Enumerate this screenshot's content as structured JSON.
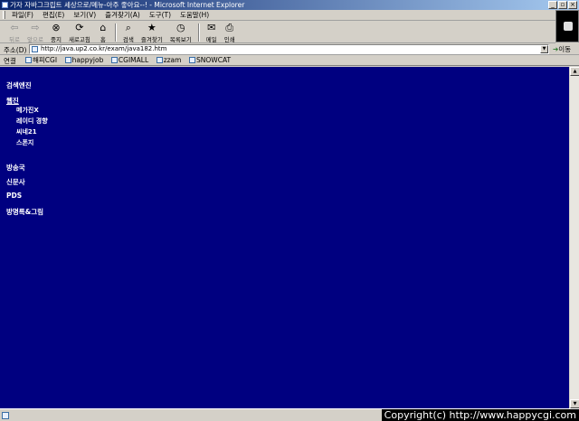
{
  "window": {
    "title": "가자 자바그크립트 세상으로/메뉴-아주 좋아요--! - Microsoft Internet Explorer",
    "controls": [
      "_",
      "▫",
      "×"
    ]
  },
  "menu": [
    "파일(F)",
    "편집(E)",
    "보기(V)",
    "즐겨찾기(A)",
    "도구(T)",
    "도움말(H)"
  ],
  "toolbar": [
    {
      "label": "뒤로",
      "icon": "back-arrow-icon",
      "glyph": "⇦",
      "disabled": true
    },
    {
      "label": "앞으로",
      "icon": "forward-arrow-icon",
      "glyph": "⇨",
      "disabled": true
    },
    {
      "label": "중지",
      "icon": "stop-icon",
      "glyph": "⊗",
      "disabled": false
    },
    {
      "label": "새로고침",
      "icon": "refresh-icon",
      "glyph": "⟳",
      "disabled": false
    },
    {
      "label": "홈",
      "icon": "home-icon",
      "glyph": "⌂",
      "disabled": false
    },
    {
      "label": "검색",
      "icon": "search-icon",
      "glyph": "⌕",
      "disabled": false
    },
    {
      "label": "즐겨찾기",
      "icon": "favorites-icon",
      "glyph": "★",
      "disabled": false
    },
    {
      "label": "목록보기",
      "icon": "history-icon",
      "glyph": "◷",
      "disabled": false
    },
    {
      "label": "메일",
      "icon": "mail-icon",
      "glyph": "✉",
      "disabled": false
    },
    {
      "label": "인쇄",
      "icon": "print-icon",
      "glyph": "⎙",
      "disabled": false
    }
  ],
  "address": {
    "label": "주소(D)",
    "url": "http://java.up2.co.kr/exam/java182.htm",
    "go_label": "이동"
  },
  "links": {
    "label": "연결",
    "items": [
      "해피CGI",
      "happyjob",
      "CGIMALL",
      "zzam",
      "SNOWCAT"
    ]
  },
  "content": {
    "background": "#000080",
    "menu": [
      {
        "label": "검색엔진",
        "active": false,
        "sub": []
      },
      {
        "label": "웹진",
        "active": true,
        "sub": [
          "메가진X",
          "레이디 경향",
          "씨네21",
          "스폰지"
        ]
      },
      {
        "label": "방송국",
        "active": false,
        "sub": []
      },
      {
        "label": "신문사",
        "active": false,
        "sub": []
      },
      {
        "label": "PDS",
        "active": false,
        "sub": []
      },
      {
        "label": "방명록&그림",
        "active": false,
        "sub": []
      }
    ]
  },
  "status": {
    "text": "",
    "watermark": "Copyright(c) http://www.happycgi.com"
  }
}
